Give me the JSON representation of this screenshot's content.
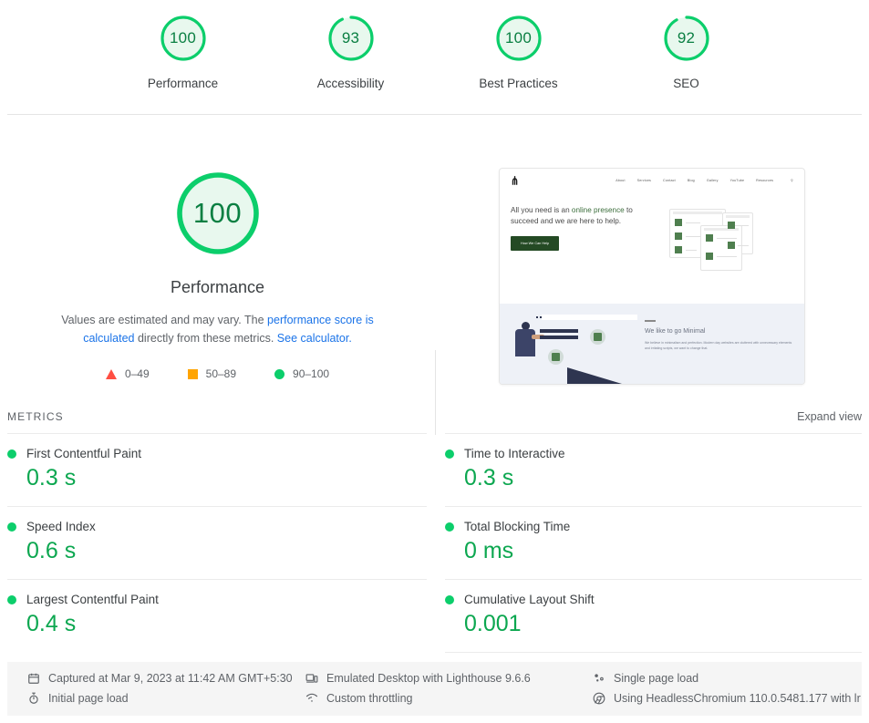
{
  "colors": {
    "pass": "#0CCE6B",
    "average": "#FFA400",
    "fail": "#FF4E42",
    "gauge_text": "#0A7F42",
    "metric_value": "#0CA750",
    "link": "#1a73e8"
  },
  "category_scores": [
    {
      "score": "100",
      "value": 100,
      "label": "Performance"
    },
    {
      "score": "93",
      "value": 93,
      "label": "Accessibility"
    },
    {
      "score": "100",
      "value": 100,
      "label": "Best Practices"
    },
    {
      "score": "92",
      "value": 92,
      "label": "SEO"
    }
  ],
  "hero": {
    "score": "100",
    "value": 100,
    "title": "Performance",
    "desc_part1": "Values are estimated and may vary. The ",
    "link1": "performance score is calculated",
    "desc_part2": " directly from these metrics. ",
    "link2": "See calculator.",
    "legend": [
      {
        "marker": "triangle-fail-icon",
        "range": "0–49"
      },
      {
        "marker": "square-average-icon",
        "range": "50–89"
      },
      {
        "marker": "circle-pass-icon",
        "range": "90–100"
      }
    ]
  },
  "thumbnail": {
    "logo": "⋔",
    "nav_links": [
      "About",
      "Services",
      "Contact",
      "Blog",
      "Gallery",
      "YouTube",
      "Resources"
    ],
    "search_icon": "search-icon",
    "headline_a": "All you need is an ",
    "headline_accent": "online presence",
    "headline_b": " to succeed and we are here to help.",
    "cta": "How We Can Help",
    "section_title": "We like to go Minimal",
    "section_body": "We believe in minimalism and perfection. Modern day websites are cluttered with unnecessary elements and irritating scripts, we want to change that."
  },
  "metrics_section": {
    "title": "METRICS",
    "expand_view": "Expand view"
  },
  "metrics": [
    {
      "name": "First Contentful Paint",
      "value": "0.3 s",
      "status": "pass"
    },
    {
      "name": "Time to Interactive",
      "value": "0.3 s",
      "status": "pass"
    },
    {
      "name": "Speed Index",
      "value": "0.6 s",
      "status": "pass"
    },
    {
      "name": "Total Blocking Time",
      "value": "0 ms",
      "status": "pass"
    },
    {
      "name": "Largest Contentful Paint",
      "value": "0.4 s",
      "status": "pass"
    },
    {
      "name": "Cumulative Layout Shift",
      "value": "0.001",
      "status": "pass"
    }
  ],
  "footer": [
    {
      "icon": "calendar-icon",
      "text": "Captured at Mar 9, 2023 at 11:42 AM GMT+5:30"
    },
    {
      "icon": "desktop-icon",
      "text": "Emulated Desktop with Lighthouse 9.6.6"
    },
    {
      "icon": "single-page-icon",
      "text": "Single page load"
    },
    {
      "icon": "stopwatch-icon",
      "text": "Initial page load"
    },
    {
      "icon": "network-icon",
      "text": "Custom throttling"
    },
    {
      "icon": "chrome-icon",
      "text": "Using HeadlessChromium 110.0.5481.177 with lr"
    }
  ]
}
